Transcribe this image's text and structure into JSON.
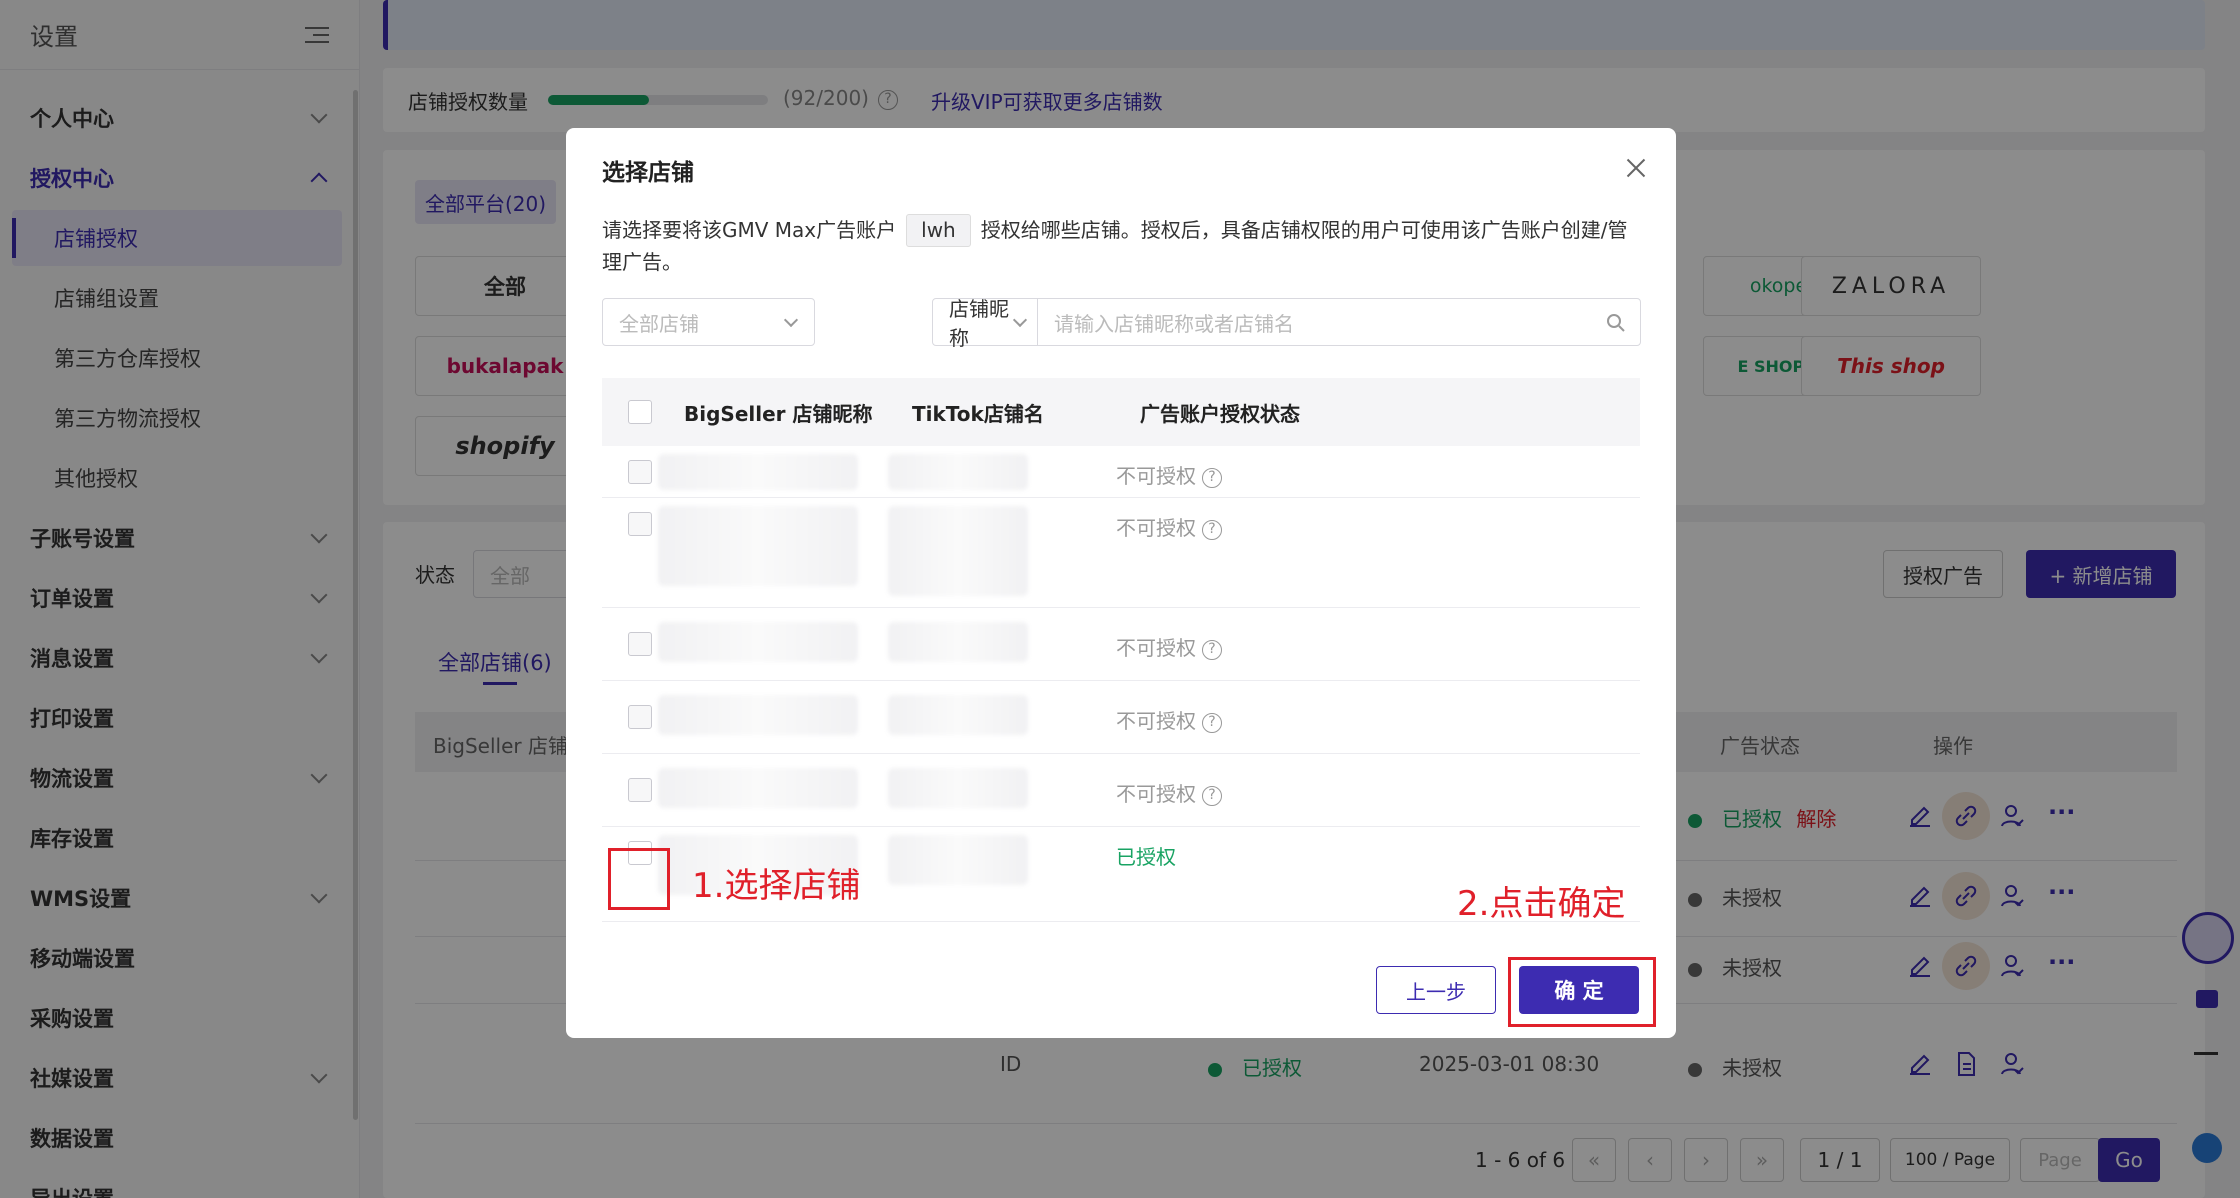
{
  "sidebar": {
    "title": "设置",
    "items": [
      {
        "label": "个人中心"
      },
      {
        "label": "授权中心"
      },
      {
        "label": "店铺授权"
      },
      {
        "label": "店铺组设置"
      },
      {
        "label": "第三方仓库授权"
      },
      {
        "label": "第三方物流授权"
      },
      {
        "label": "其他授权"
      },
      {
        "label": "子账号设置"
      },
      {
        "label": "订单设置"
      },
      {
        "label": "消息设置"
      },
      {
        "label": "打印设置"
      },
      {
        "label": "物流设置"
      },
      {
        "label": "库存设置"
      },
      {
        "label": "WMS设置"
      },
      {
        "label": "移动端设置"
      },
      {
        "label": "采购设置"
      },
      {
        "label": "社媒设置"
      },
      {
        "label": "数据设置"
      },
      {
        "label": "导出设置"
      }
    ]
  },
  "page": {
    "quota_label": "店铺授权数量",
    "quota_value": "(92/200)",
    "quota_fraction": 0.46,
    "upgrade_link": "升级VIP可获取更多店铺数",
    "platform_all_tab": "全部平台(20)",
    "platforms": [
      "全部",
      "bukalapak",
      "shopify",
      "okopedia",
      "ZALORA",
      "E SHOPPING",
      "This shop"
    ],
    "filter_status_label": "状态",
    "filter_status_value": "全部",
    "btn_auth_ads": "授权广告",
    "btn_add_store": "+ 新增店铺",
    "tab_all_stores": "全部店铺(6)",
    "table_headers": {
      "name": "BigSeller 店铺",
      "ad_status": "广告状态",
      "ops": "操作"
    },
    "rows": [
      {
        "ad_status": "已授权",
        "unlink": "解除"
      },
      {
        "ad_status": "未授权"
      },
      {
        "ad_status": "未授权"
      },
      {
        "id_label": "ID",
        "auth_status": "已授权",
        "time": "2025-03-01 08:30",
        "ad_status": "未授权"
      }
    ],
    "pagination": {
      "range": "1 - 6 of 6",
      "page": "1 / 1",
      "per_page": "100 / Page",
      "page_placeholder": "Page",
      "go": "Go"
    }
  },
  "modal": {
    "title": "选择店铺",
    "desc_before": "请选择要将该GMV Max广告账户",
    "account": "lwh",
    "desc_after": "授权给哪些店铺。授权后，具备店铺权限的用户可使用该广告账户创建/管理广告。",
    "filter_store_placeholder": "全部店铺",
    "filter_field": "店铺昵称",
    "search_placeholder": "请输入店铺昵称或者店铺名",
    "columns": [
      "BigSeller 店铺昵称",
      "TikTok店铺名",
      "广告账户授权状态"
    ],
    "rows": [
      {
        "status": "不可授权"
      },
      {
        "status": "不可授权"
      },
      {
        "status": "不可授权"
      },
      {
        "status": "不可授权"
      },
      {
        "status": "不可授权"
      },
      {
        "status": "已授权"
      }
    ],
    "btn_prev": "上一步",
    "btn_confirm": "确 定"
  },
  "annotations": {
    "step1": "1.选择店铺",
    "step2": "2.点击确定"
  },
  "colors": {
    "brand": "#3d2cb1",
    "success": "#19a363",
    "annotation": "#e0202a"
  }
}
